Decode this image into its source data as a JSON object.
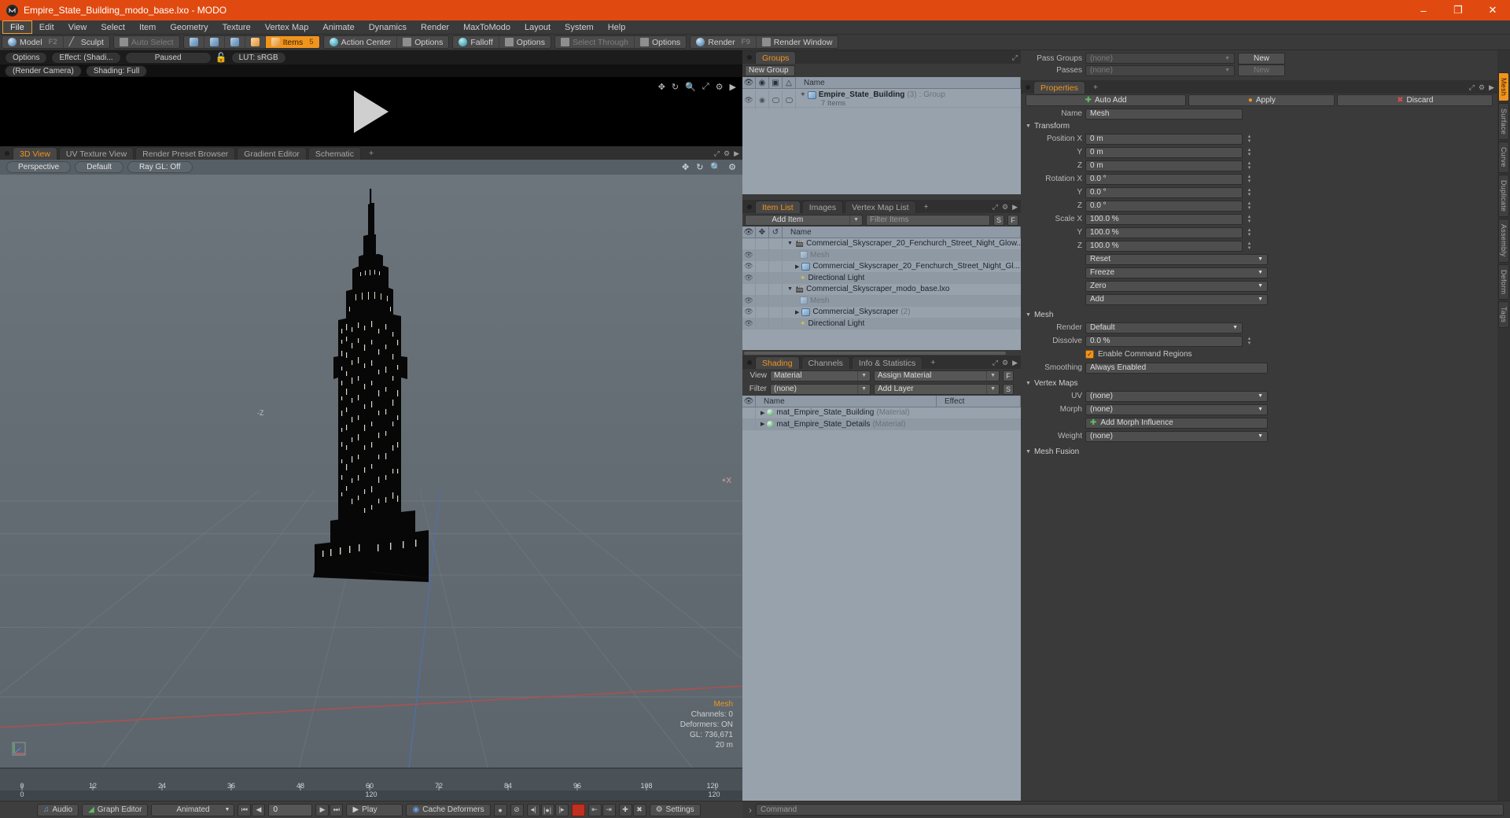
{
  "window": {
    "title": "Empire_State_Building_modo_base.lxo - MODO",
    "logo_icon": "modo-logo-icon",
    "accent_color": "#e04a10",
    "minimize": "–",
    "maximize": "❐",
    "close": "✕"
  },
  "menu": {
    "items": [
      {
        "label": "File",
        "active": true
      },
      {
        "label": "Edit",
        "active": false
      },
      {
        "label": "View",
        "active": false
      },
      {
        "label": "Select",
        "active": false
      },
      {
        "label": "Item",
        "active": false
      },
      {
        "label": "Geometry",
        "active": false
      },
      {
        "label": "Texture",
        "active": false
      },
      {
        "label": "Vertex Map",
        "active": false
      },
      {
        "label": "Animate",
        "active": false
      },
      {
        "label": "Dynamics",
        "active": false
      },
      {
        "label": "Render",
        "active": false
      },
      {
        "label": "MaxToModo",
        "active": false
      },
      {
        "label": "Layout",
        "active": false
      },
      {
        "label": "System",
        "active": false
      },
      {
        "label": "Help",
        "active": false
      }
    ]
  },
  "modebar": {
    "model": "Model",
    "model_key": "F2",
    "sculpt": "Sculpt",
    "auto_select": "Auto Select",
    "items": "Items",
    "items_key": "5",
    "action_center": "Action Center",
    "options1": "Options",
    "falloff": "Falloff",
    "options2": "Options",
    "select_through": "Select Through",
    "options3": "Options",
    "render": "Render",
    "render_key": "F9",
    "render_window": "Render Window"
  },
  "preview": {
    "options": "Options",
    "effect": "Effect: (Shadi...",
    "status": "Paused",
    "lock_icon": "unlock-icon",
    "lut": "LUT: sRGB",
    "camera": "(Render Camera)",
    "shading": "Shading: Full",
    "play_icon": "play-icon",
    "toolbar_icons": [
      "move-icon",
      "rotate-icon",
      "zoom-icon",
      "fit-icon",
      "gear-icon",
      "chevron-right-icon"
    ]
  },
  "viewport": {
    "tabs": [
      {
        "label": "3D View",
        "sel": true
      },
      {
        "label": "UV Texture View",
        "sel": false
      },
      {
        "label": "Render Preset Browser",
        "sel": false
      },
      {
        "label": "Gradient Editor",
        "sel": false
      },
      {
        "label": "Schematic",
        "sel": false
      }
    ],
    "tab_add": "+",
    "controls": [
      "Perspective",
      "Default",
      "Ray GL: Off"
    ],
    "icons": [
      "move-icon",
      "rotate-icon",
      "zoom-icon",
      "gear-icon"
    ],
    "readout": {
      "title": "Mesh",
      "channels": "Channels: 0",
      "deformers": "Deformers: ON",
      "gl": "GL: 736,671",
      "scale": "20 m"
    },
    "axis_plus_x": "+X",
    "axis_label_z": "-Z"
  },
  "timeline": {
    "ticks": [
      "0",
      "12",
      "24",
      "36",
      "48",
      "60",
      "72",
      "84",
      "96",
      "108",
      "120"
    ],
    "range_start": "0",
    "range_mid": "120",
    "range_end": "120"
  },
  "groups": {
    "tab": "Groups",
    "new_group_button": "New Group",
    "columns": [
      "eye-icon",
      "render-icon",
      "shade-icon",
      "lock-icon",
      "Name"
    ],
    "rows": [
      {
        "expand": "+",
        "icon": "group-icon",
        "name": "Empire_State_Building",
        "count": "(3)",
        "type": ": Group",
        "sub": "7 Items"
      }
    ]
  },
  "item_list": {
    "tabs": [
      {
        "label": "Item List",
        "sel": true
      },
      {
        "label": "Images",
        "sel": false
      },
      {
        "label": "Vertex Map List",
        "sel": false
      }
    ],
    "tab_add": "+",
    "add_item": "Add Item",
    "filter_placeholder": "Filter Items",
    "btn_s": "S",
    "btn_f": "F",
    "columns": [
      "eye-icon",
      "move-icon",
      "axis-icon",
      "Name"
    ],
    "rows": [
      {
        "indent": 0,
        "tri": "▼",
        "icon": "scene-icon",
        "name": "Commercial_Skyscraper_20_Fenchurch_Street_Night_Glow...",
        "eye": false,
        "dim": false
      },
      {
        "indent": 1,
        "tri": "",
        "icon": "mesh-icon",
        "name": "Mesh",
        "eye": true,
        "dim": true
      },
      {
        "indent": 1,
        "tri": "▶",
        "icon": "group-icon",
        "name": "Commercial_Skyscraper_20_Fenchurch_Street_Night_Gl...",
        "eye": true,
        "dim": false
      },
      {
        "indent": 1,
        "tri": "",
        "icon": "light-icon",
        "name": "Directional Light",
        "eye": true,
        "dim": false
      },
      {
        "indent": 0,
        "tri": "▼",
        "icon": "scene-icon",
        "name": "Commercial_Skyscraper_modo_base.lxo",
        "eye": false,
        "dim": false
      },
      {
        "indent": 1,
        "tri": "",
        "icon": "mesh-icon",
        "name": "Mesh",
        "eye": true,
        "dim": true
      },
      {
        "indent": 1,
        "tri": "▶",
        "icon": "group-icon",
        "name": "Commercial_Skyscraper",
        "count": "(2)",
        "eye": true,
        "dim": false
      },
      {
        "indent": 1,
        "tri": "",
        "icon": "light-icon",
        "name": "Directional Light",
        "eye": true,
        "dim": false
      }
    ]
  },
  "shading": {
    "tabs": [
      {
        "label": "Shading",
        "sel": true
      },
      {
        "label": "Channels",
        "sel": false
      },
      {
        "label": "Info & Statistics",
        "sel": false
      }
    ],
    "tab_add": "+",
    "view_label": "View",
    "view_value": "Material",
    "assign_material": "Assign Material",
    "assign_f": "F",
    "filter_label": "Filter",
    "filter_value": "(none)",
    "add_layer": "Add Layer",
    "add_layer_s": "S",
    "columns": [
      "eye-icon",
      "Name",
      "Effect"
    ],
    "rows": [
      {
        "tri": "▶",
        "name": "mat_Empire_State_Building",
        "type": "(Material)",
        "effect": ""
      },
      {
        "tri": "▶",
        "name": "mat_Empire_State_Details",
        "type": "(Material)",
        "effect": ""
      }
    ]
  },
  "render_props": {
    "pass_groups_label": "Pass Groups",
    "pass_groups_value": "(none)",
    "pass_groups_new": "New",
    "passes_label": "Passes",
    "passes_value": "(none)",
    "passes_new": "New"
  },
  "properties": {
    "tab": "Properties",
    "tab_add": "+",
    "auto_add": "Auto Add",
    "apply": "Apply",
    "discard": "Discard",
    "name_label": "Name",
    "name_value": "Mesh",
    "transform": {
      "title": "Transform",
      "fields": [
        {
          "label": "Position X",
          "value": "0 m"
        },
        {
          "label": "Y",
          "value": "0 m"
        },
        {
          "label": "Z",
          "value": "0 m"
        },
        {
          "label": "Rotation X",
          "value": "0.0 °"
        },
        {
          "label": "Y",
          "value": "0.0 °"
        },
        {
          "label": "Z",
          "value": "0.0 °"
        },
        {
          "label": "Scale X",
          "value": "100.0 %"
        },
        {
          "label": "Y",
          "value": "100.0 %"
        },
        {
          "label": "Z",
          "value": "100.0 %"
        }
      ],
      "actions": [
        "Reset",
        "Freeze",
        "Zero",
        "Add"
      ]
    },
    "mesh": {
      "title": "Mesh",
      "render_label": "Render",
      "render_value": "Default",
      "dissolve_label": "Dissolve",
      "dissolve_value": "0.0 %",
      "enable_command_regions": "Enable Command Regions",
      "smoothing_label": "Smoothing",
      "smoothing_value": "Always Enabled"
    },
    "vertex_maps": {
      "title": "Vertex Maps",
      "uv_label": "UV",
      "uv_value": "(none)",
      "morph_label": "Morph",
      "morph_value": "(none)",
      "add_morph_influence": "Add Morph Influence",
      "weight_label": "Weight",
      "weight_value": "(none)"
    },
    "mesh_fusion": {
      "title": "Mesh Fusion"
    }
  },
  "vstrip": {
    "tabs": [
      {
        "label": "Mesh",
        "sel": true
      },
      {
        "label": "Surface",
        "sel": false
      },
      {
        "label": "Curve",
        "sel": false
      },
      {
        "label": "Duplicate",
        "sel": false
      },
      {
        "label": "Assembly",
        "sel": false
      },
      {
        "label": "Deform",
        "sel": false
      },
      {
        "label": "Tags",
        "sel": false
      }
    ]
  },
  "bottombar": {
    "audio": "Audio",
    "graph_editor": "Graph Editor",
    "animated": "Animated",
    "frame_value": "0",
    "play": "Play",
    "cache_deformers": "Cache Deformers",
    "settings": "Settings",
    "prev_key_icon": "skip-back-icon",
    "step_back_icon": "step-back-icon",
    "step_fwd_icon": "step-forward-icon",
    "skip_fwd_icon": "skip-forward-icon",
    "record_icon": "record-icon"
  },
  "command": {
    "chevron": "›",
    "placeholder": "Command"
  }
}
